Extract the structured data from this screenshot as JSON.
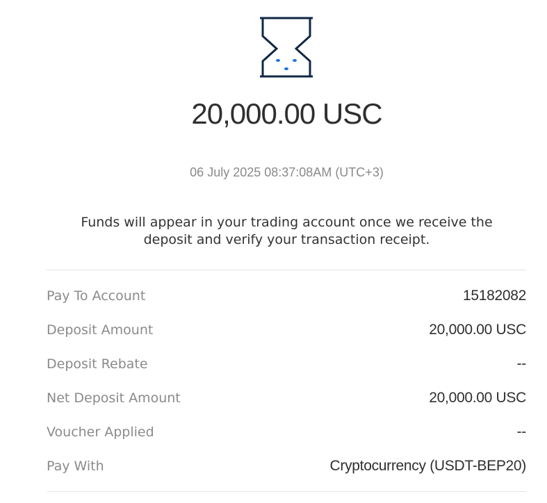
{
  "status_icon": "hourglass-icon",
  "colors": {
    "icon_frame": "#0f2744",
    "icon_sand": "#1a73e8",
    "amount_text": "#2f2f2f",
    "muted_text": "#8a8a8a",
    "divider": "#e4e4e4"
  },
  "amount": "20,000.00 USC",
  "timestamp": "06 July 2025 08:37:08AM (UTC+3)",
  "message": "Funds will appear in your trading account once we receive the deposit and verify your transaction receipt.",
  "details": [
    {
      "label": "Pay To Account",
      "value": "15182082"
    },
    {
      "label": "Deposit Amount",
      "value": "20,000.00 USC"
    },
    {
      "label": "Deposit Rebate",
      "value": "--"
    },
    {
      "label": "Net Deposit Amount",
      "value": "20,000.00 USC"
    },
    {
      "label": "Voucher Applied",
      "value": "--"
    },
    {
      "label": "Pay With",
      "value": "Cryptocurrency (USDT-BEP20)"
    }
  ]
}
